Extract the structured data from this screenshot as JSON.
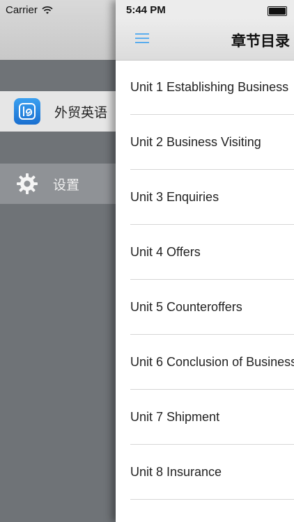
{
  "status": {
    "carrier": "Carrier",
    "time": "5:44 PM"
  },
  "drawer": {
    "items": [
      {
        "label": "外贸英语",
        "icon": "app-logo-icon"
      },
      {
        "label": "设置",
        "icon": "gear-icon"
      }
    ]
  },
  "nav": {
    "title": "章节目录",
    "menu_icon": "hamburger-menu-icon"
  },
  "units": [
    "Unit 1 Establishing Business",
    "Unit 2 Business Visiting",
    "Unit 3 Enquiries",
    "Unit 4 Offers",
    "Unit 5 Counteroffers",
    "Unit 6 Conclusion of Business",
    "Unit 7 Shipment",
    "Unit 8 Insurance"
  ],
  "colors": {
    "accent": "#3aa0f0",
    "drawer_bg": "#6f7377"
  }
}
